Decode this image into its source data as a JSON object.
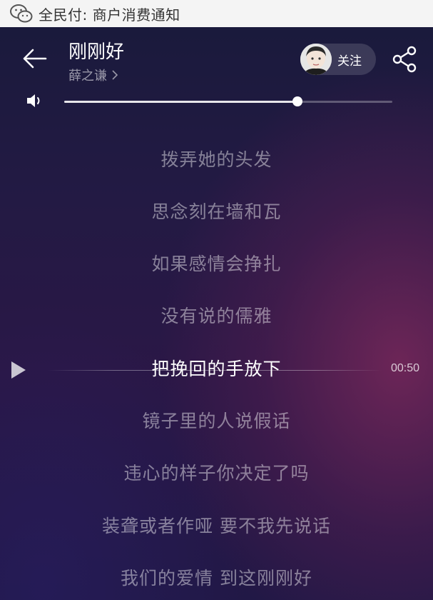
{
  "notification": {
    "text": "全民付: 商户消费通知",
    "icon": "wechat-icon"
  },
  "header": {
    "song_title": "刚刚好",
    "artist": "薛之谦",
    "follow_label": "关注"
  },
  "volume": {
    "level": 0.71
  },
  "lyrics": [
    {
      "text": "拨弄她的头发",
      "active": false
    },
    {
      "text": "思念刻在墙和瓦",
      "active": false
    },
    {
      "text": "如果感情会挣扎",
      "active": false
    },
    {
      "text": "没有说的儒雅",
      "active": false
    },
    {
      "text": "把挽回的手放下",
      "active": true
    },
    {
      "text": "镜子里的人说假话",
      "active": false
    },
    {
      "text": "违心的样子你决定了吗",
      "active": false
    },
    {
      "text": "装聋或者作哑 要不我先说话",
      "active": false
    },
    {
      "text": "我们的爱情 到这刚刚好",
      "active": false
    }
  ],
  "seek": {
    "time": "00:50"
  },
  "colors": {
    "accent": "#ffffff",
    "background_top": "#1a1a3c",
    "background_glow": "#78285a"
  }
}
